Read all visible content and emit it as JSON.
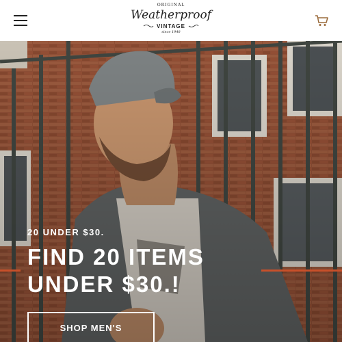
{
  "header": {
    "logo": {
      "original": "ORIGINAL",
      "wordmark": "Weatherproof",
      "vintage": "VINTAGE",
      "since": "since 1948"
    },
    "menu_icon": "hamburger-menu-icon",
    "cart_icon": "shopping-cart-icon"
  },
  "hero": {
    "eyebrow": "20 UNDER $30.",
    "headline": "FIND 20 ITEMS UNDER $30.!",
    "cta_label": "SHOP MEN'S",
    "image": "man-in-gray-cap-and-jacket-by-iron-fence-photo"
  },
  "colors": {
    "accent": "#c8502a",
    "brick": "#8a4a32",
    "header_bg": "#ffffff"
  }
}
